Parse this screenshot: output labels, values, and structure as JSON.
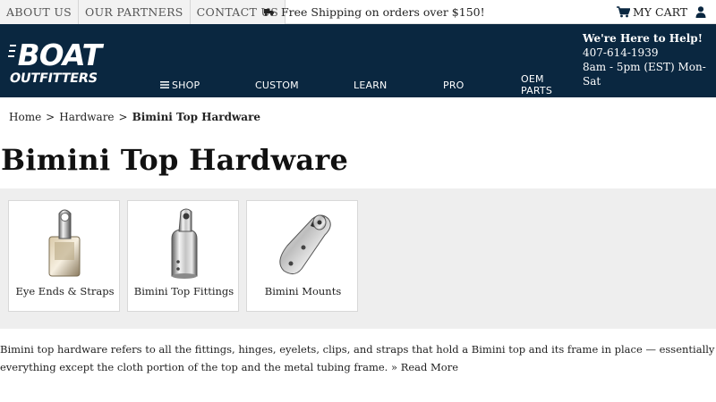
{
  "topbar": {
    "links": [
      "ABOUT US",
      "OUR PARTNERS",
      "CONTACT US"
    ],
    "shipping_text": "Free Shipping on orders over $150!",
    "cart_label": "MY CART",
    "user_icon": "user-icon",
    "truck_icon": "truck-icon",
    "cart_icon": "shopping-cart-icon"
  },
  "header": {
    "logo_line1": "BOAT",
    "logo_line2": "OUTFITTERS",
    "nav": [
      "SHOP",
      "CUSTOM",
      "LEARN",
      "PRO",
      "OEM PARTS"
    ],
    "menu_icon": "menu-icon",
    "help": {
      "title": "We're Here to Help!",
      "phone": "407-614-1939",
      "hours": "8am - 5pm (EST) Mon-Sat"
    }
  },
  "breadcrumb": {
    "items": [
      "Home",
      "Hardware"
    ],
    "separator": ">",
    "current": "Bimini Top Hardware"
  },
  "page_title": "Bimini Top Hardware",
  "categories": [
    {
      "label": "Eye Ends & Straps",
      "icon": "eye-end-fitting-icon"
    },
    {
      "label": "Bimini Top Fittings",
      "icon": "bimini-top-fitting-icon"
    },
    {
      "label": "Bimini Mounts",
      "icon": "bimini-mount-icon"
    }
  ],
  "description": {
    "text": "Bimini top hardware refers to all the fittings, hinges, eyelets, clips, and straps that hold a Bimini top and its frame in place — essentially everything except the cloth portion of the top and the metal tubing frame.",
    "more": "» Read More"
  },
  "colors": {
    "header_bg": "#0a2740",
    "category_bg": "#eeeeee"
  }
}
